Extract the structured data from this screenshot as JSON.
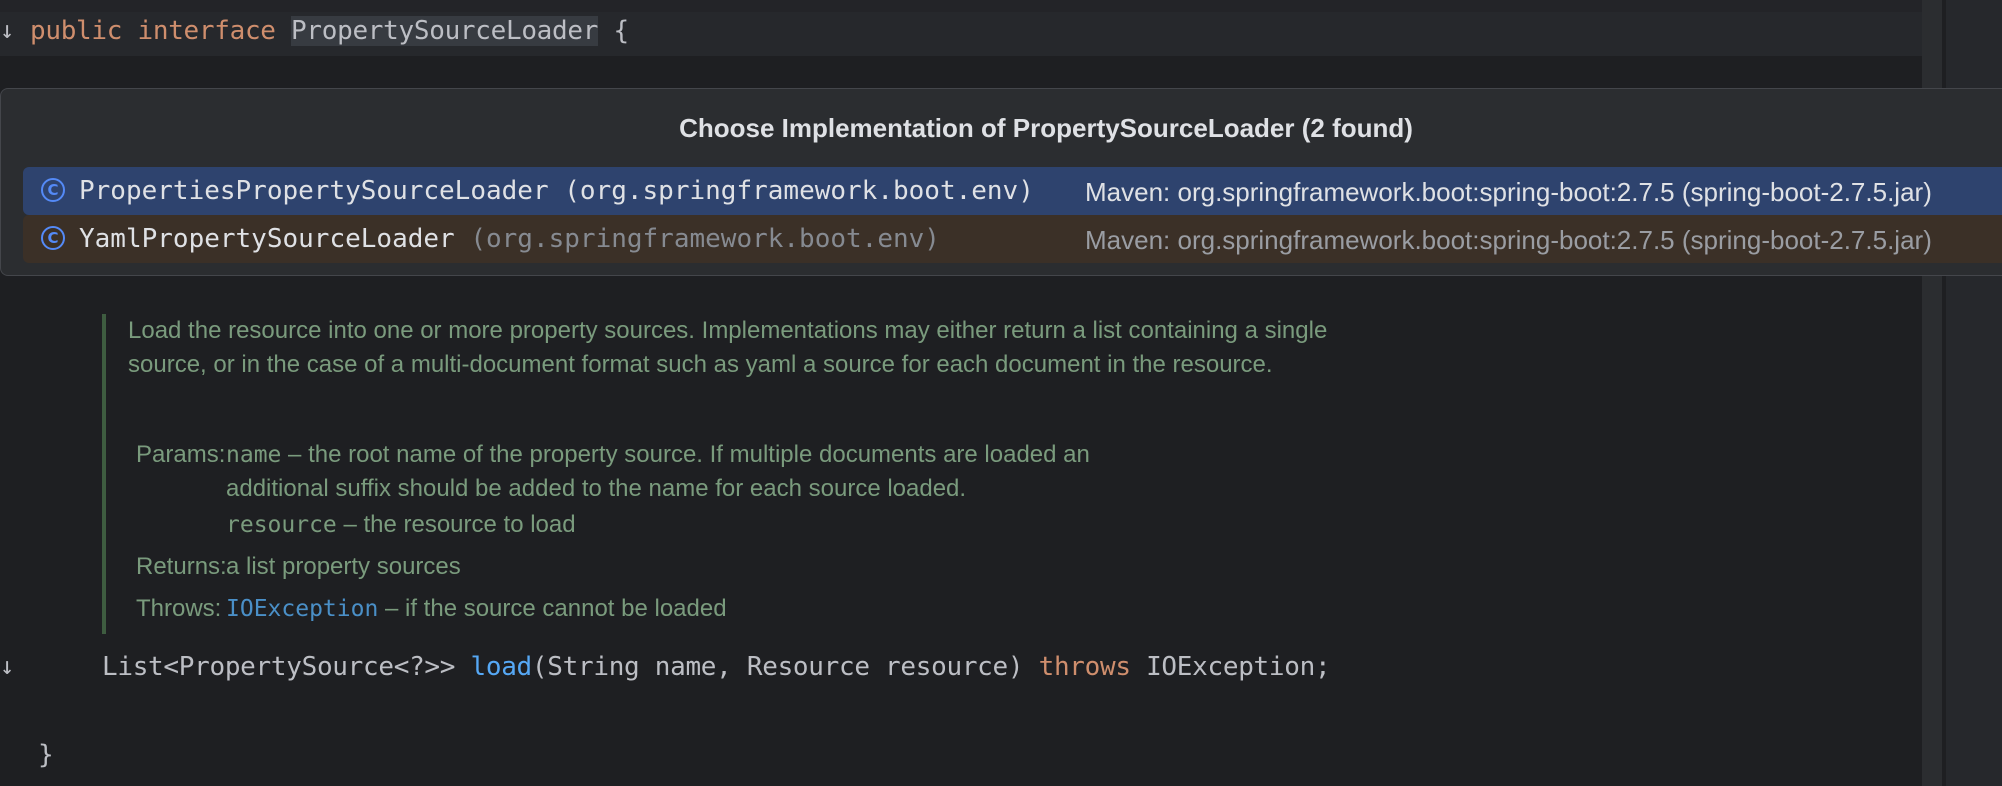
{
  "editor": {
    "line1": {
      "kw_public": "public",
      "kw_interface": "interface",
      "name": "PropertySourceLoader",
      "brace": "{"
    },
    "method": {
      "ret_type": "List<PropertySource<?>>",
      "name": "load",
      "params": "(String name, Resource resource)",
      "throws_kw": "throws",
      "exception": "IOException;"
    },
    "closing_brace": "}",
    "gutter_arrow": "↓"
  },
  "popup": {
    "title": "Choose Implementation of PropertySourceLoader (2 found)",
    "items": [
      {
        "icon": "class-icon",
        "icon_glyph": "C",
        "name": "PropertiesPropertySourceLoader",
        "package": " (org.springframework.boot.env)",
        "location": "Maven: org.springframework.boot:spring-boot:2.7.5 (spring-boot-2.7.5.jar)",
        "selected": true
      },
      {
        "icon": "class-icon",
        "icon_glyph": "C",
        "name": "YamlPropertySourceLoader",
        "package": " (org.springframework.boot.env)",
        "location": "Maven: org.springframework.boot:spring-boot:2.7.5 (spring-boot-2.7.5.jar)",
        "selected": false
      }
    ]
  },
  "doc": {
    "description": "Load the resource into one or more property sources. Implementations may either return a list containing a single source, or in the case of a multi-document format such as yaml a source for each document in the resource.",
    "params_label": "Params:",
    "param1_name": "name",
    "param1_text": " – the root name of the property source. If multiple documents are loaded an",
    "param1_text2": "additional suffix should be added to the name for each source loaded.",
    "param2_name": "resource",
    "param2_text": " – the resource to load",
    "returns_label": "Returns:",
    "returns_text": "a list property sources",
    "throws_label": "Throws:",
    "throws_link": "IOException",
    "throws_text": " – if the source cannot be loaded"
  }
}
